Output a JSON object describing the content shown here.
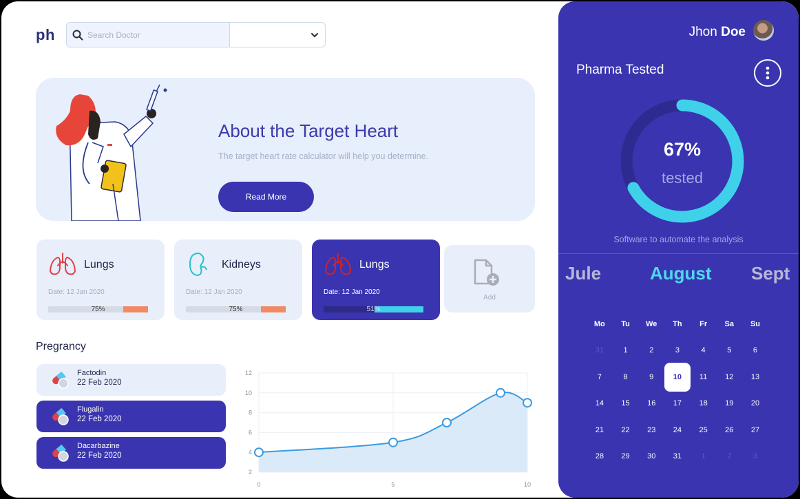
{
  "logo": "ph",
  "search": {
    "placeholder": "Search Doctor",
    "select_value": ""
  },
  "hero": {
    "title_prefix": "About the ",
    "title_emphasis": "Target Heart",
    "subtitle": "The target heart rate calculator will help you determine.",
    "button": "Read More"
  },
  "organs": [
    {
      "name": "Lungs",
      "date": "Date: 12 Jan 2020",
      "progress": "75%",
      "icon": "lungs-icon",
      "color": "#e0424a",
      "active": false
    },
    {
      "name": "Kidneys",
      "date": "Date: 12 Jan 2020",
      "progress": "75%",
      "icon": "kidney-icon",
      "color": "#2ac0c6",
      "active": false
    },
    {
      "name": "Lungs",
      "date": "Date: 12 Jan 2020",
      "progress": "51%",
      "icon": "lungs-icon",
      "color": "#c7262e",
      "active": true
    }
  ],
  "add_card": {
    "label": "Add",
    "icon": "add-file-icon"
  },
  "pregnancy": {
    "title": "Pregrancy",
    "items": [
      {
        "name": "Factodin",
        "date": "22 Feb 2020",
        "active": false
      },
      {
        "name": "Flugalin",
        "date": "22 Feb 2020",
        "active": true
      },
      {
        "name": "Dacarbazine",
        "date": "22 Feb 2020",
        "active": true
      }
    ]
  },
  "chart_data": {
    "type": "area",
    "title": "",
    "xlabel": "",
    "ylabel": "",
    "x_ticks": [
      0,
      5,
      10
    ],
    "y_ticks": [
      2,
      4,
      6,
      8,
      10,
      12
    ],
    "xlim": [
      0,
      10
    ],
    "ylim": [
      2,
      12
    ],
    "grid": true,
    "series": [
      {
        "x": [
          0,
          5,
          7,
          9,
          10
        ],
        "y": [
          4,
          5,
          7,
          10,
          9
        ]
      }
    ],
    "color": "#3a9be0",
    "fill": "#dbeaf9"
  },
  "panel": {
    "user_first": "Jhon",
    "user_last": "Doe",
    "title": "Pharma Tested",
    "ring_value": "67%",
    "ring_fraction": 0.67,
    "ring_label": "tested",
    "caption": "Software to automate the analysis",
    "months": {
      "prev": "Jule",
      "current": "August",
      "next": "Sept"
    },
    "weekdays": [
      "Mo",
      "Tu",
      "We",
      "Th",
      "Fr",
      "Sa",
      "Su"
    ],
    "weeks": [
      [
        "31",
        "1",
        "2",
        "3",
        "4",
        "5",
        "6"
      ],
      [
        "7",
        "8",
        "9",
        "10",
        "11",
        "12",
        "13"
      ],
      [
        "14",
        "15",
        "16",
        "17",
        "18",
        "19",
        "20"
      ],
      [
        "21",
        "22",
        "23",
        "24",
        "25",
        "26",
        "27"
      ],
      [
        "28",
        "29",
        "30",
        "31",
        "1",
        "2",
        "3"
      ]
    ],
    "selected_day": "10",
    "accent": "#3a34b0",
    "ring_color": "#3fd1ea"
  }
}
